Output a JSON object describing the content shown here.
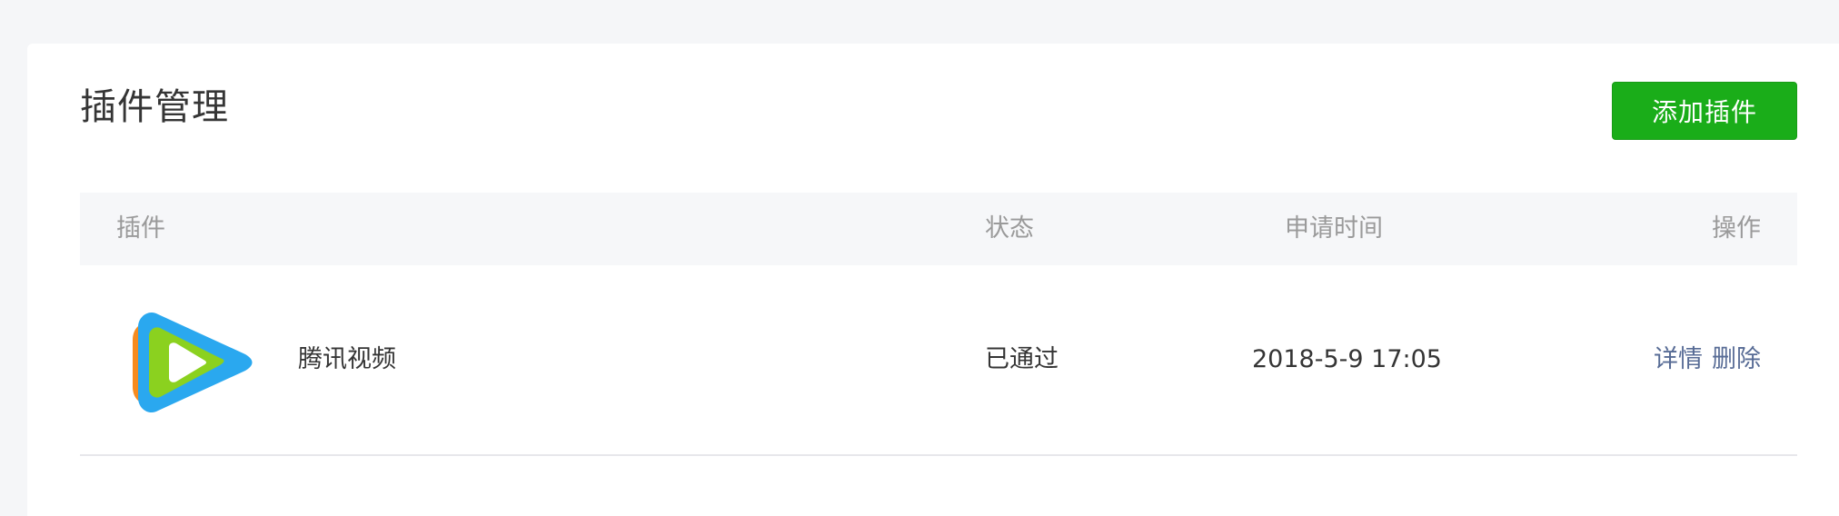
{
  "header": {
    "title": "插件管理",
    "add_button_label": "添加插件"
  },
  "table": {
    "columns": {
      "plugin": "插件",
      "status": "状态",
      "apply_time": "申请时间",
      "actions": "操作"
    },
    "rows": [
      {
        "name": "腾讯视频",
        "icon": "tencent-video-logo",
        "status": "已通过",
        "apply_time": "2018-5-9 17:05",
        "actions": {
          "detail": "详情",
          "delete": "删除"
        }
      }
    ]
  },
  "colors": {
    "primary_button": "#1aad19",
    "link": "#576b95",
    "header_bg": "#f6f7f9",
    "page_bg": "#f5f6f8"
  }
}
